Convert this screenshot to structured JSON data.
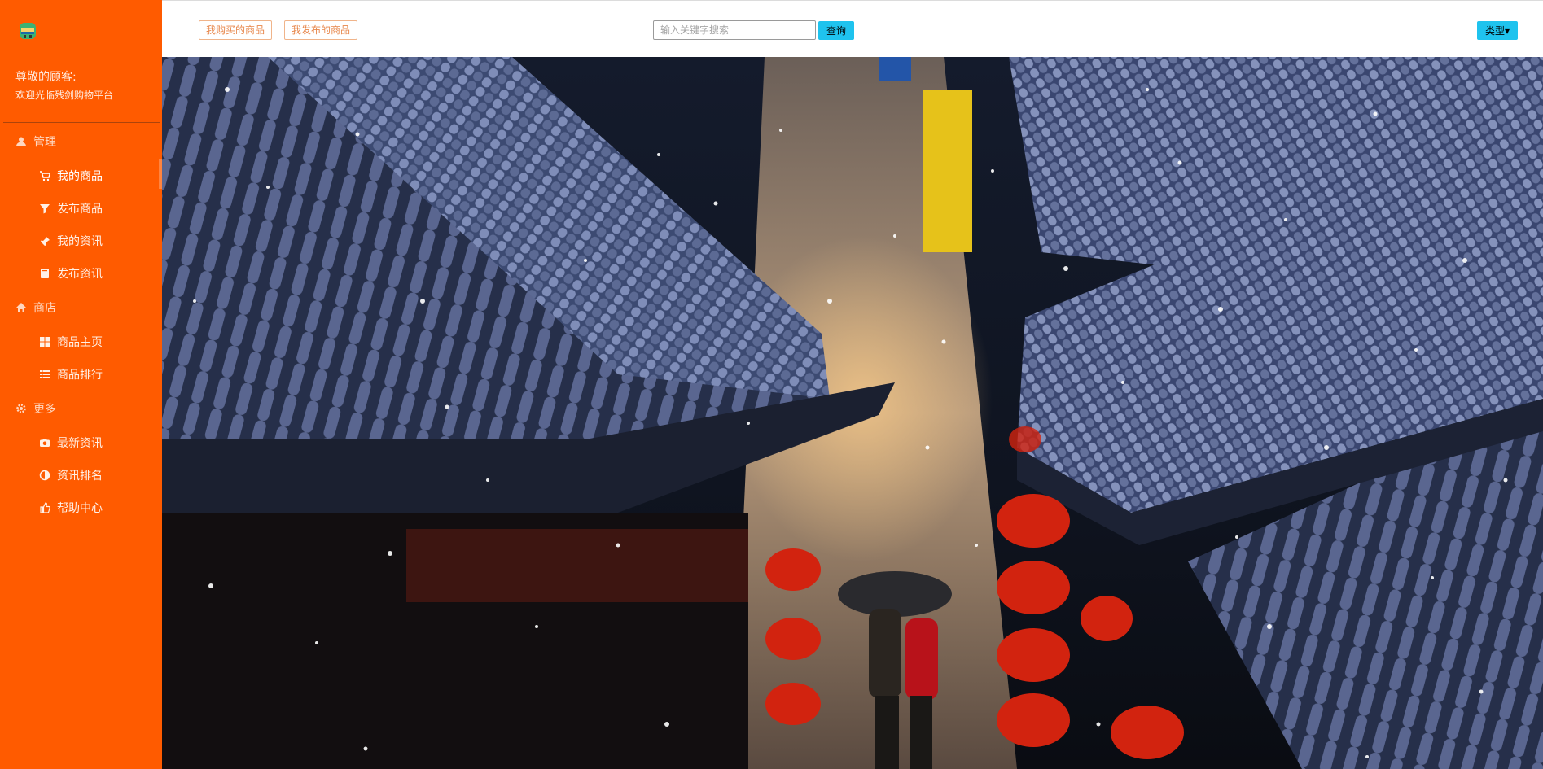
{
  "sidebar": {
    "greeting_title": "尊敬的顾客:",
    "greeting_sub": "欢迎光临残剑购物平台",
    "sections": [
      {
        "label": "管理",
        "icon": "user-icon",
        "items": [
          {
            "label": "我的商品",
            "icon": "cart-icon",
            "active": true
          },
          {
            "label": "发布商品",
            "icon": "filter-icon"
          },
          {
            "label": "我的资讯",
            "icon": "pin-icon"
          },
          {
            "label": "发布资讯",
            "icon": "book-icon"
          }
        ]
      },
      {
        "label": "商店",
        "icon": "home-icon",
        "items": [
          {
            "label": "商品主页",
            "icon": "grid-icon"
          },
          {
            "label": "商品排行",
            "icon": "list-icon"
          }
        ]
      },
      {
        "label": "更多",
        "icon": "gear-icon",
        "items": [
          {
            "label": "最新资讯",
            "icon": "camera-icon"
          },
          {
            "label": "资讯排名",
            "icon": "contrast-icon"
          },
          {
            "label": "帮助中心",
            "icon": "thumb-icon"
          }
        ]
      }
    ]
  },
  "topbar": {
    "bought_label": "我购买的商品",
    "published_label": "我发布的商品",
    "search_placeholder": "输入关键字搜索",
    "search_button": "查询",
    "type_button": "类型▾"
  },
  "colors": {
    "sidebar": "#ff5b00",
    "accent_button": "#1fc3ee"
  }
}
